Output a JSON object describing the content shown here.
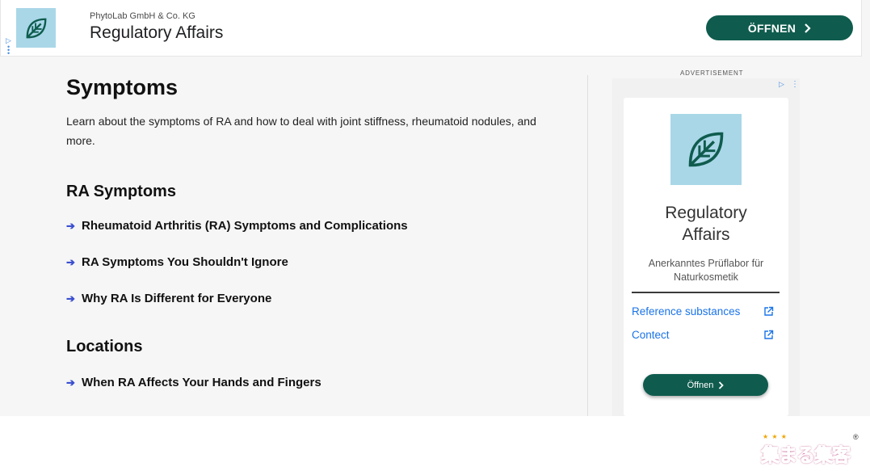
{
  "top_ad": {
    "company": "PhytoLab GmbH & Co. KG",
    "title": "Regulatory Affairs",
    "open_label": "ÖFFNEN",
    "brand_color": "#0f5c4e",
    "logo_bg": "#a9d7e8",
    "logo_icon": "leaf-icon"
  },
  "main": {
    "title": "Symptoms",
    "intro": "Learn about the symptoms of RA and how to deal with joint stiffness, rheumatoid nodules, and more.",
    "sections": [
      {
        "heading": "RA Symptoms",
        "links": [
          "Rheumatoid Arthritis (RA) Symptoms and Complications",
          "RA Symptoms You Shouldn't Ignore",
          "Why RA Is Different for Everyone"
        ]
      },
      {
        "heading": "Locations",
        "links": [
          "When RA Affects Your Hands and Fingers"
        ]
      }
    ],
    "link_arrow_color": "#3b4fcf"
  },
  "sidebar_ad": {
    "label": "ADVERTISEMENT",
    "title": "Regulatory Affairs",
    "subtitle": "Anerkanntes Prüflabor für Naturkosmetik",
    "links": [
      {
        "label": "Reference substances",
        "icon": "external-link-icon"
      },
      {
        "label": "Contect",
        "icon": "external-link-icon"
      }
    ],
    "open_label": "Öffnen"
  },
  "watermark": {
    "text": "集まる集客",
    "registered": "®",
    "stars": "★ ★ ★"
  }
}
